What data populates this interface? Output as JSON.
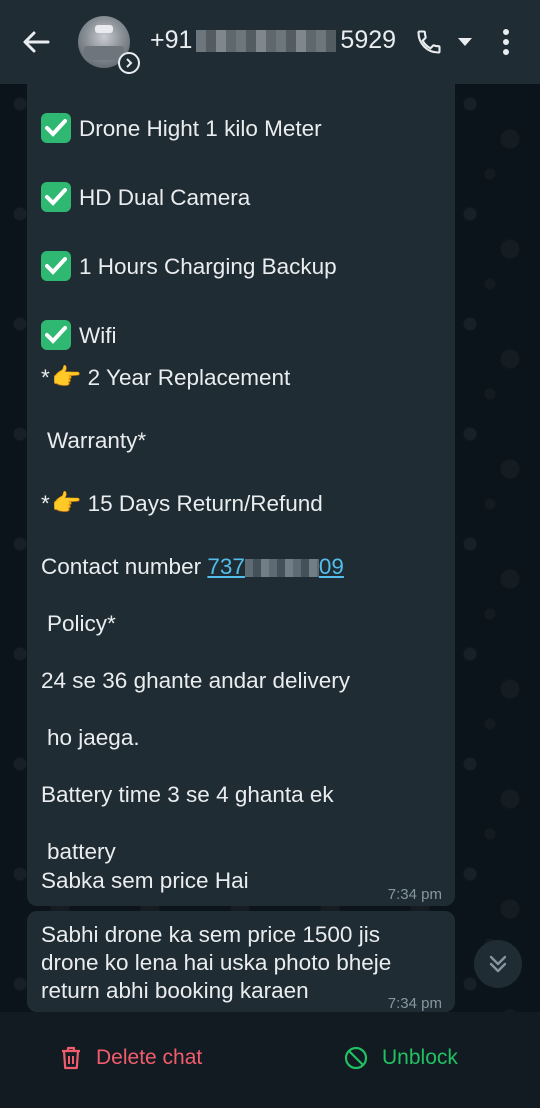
{
  "header": {
    "contact_prefix": "+91",
    "contact_suffix": "5929"
  },
  "messages": [
    {
      "lines": [
        "Drone Hight 1 kilo Meter",
        "HD Dual Camera",
        "1 Hours Charging Backup",
        "Wifi",
        "2 Year Replacement",
        "Warranty*",
        "15 Days Return/Refund",
        "Contact number",
        "Policy*",
        "24 se 36 ghante andar delivery",
        "ho jaega.",
        "Battery time 3 se 4 ghanta ek",
        "battery",
        "Sabka sem price Hai"
      ],
      "contact_link_prefix": "737",
      "contact_link_suffix": "09",
      "time": "7:34 pm"
    },
    {
      "lines": [
        "Sabhi drone ka sem price 1500 jis",
        "drone ko lena hai uska photo bheje",
        "return abhi booking karaen"
      ],
      "time": "7:34 pm"
    }
  ],
  "bottom": {
    "delete_label": "Delete chat",
    "unblock_label": "Unblock"
  },
  "colors": {
    "header_bg": "#1f2c34",
    "bubble_bg": "#202c33",
    "link": "#53bdeb",
    "delete": "#f15c6d",
    "unblock": "#21c063",
    "check": "#2eb872"
  },
  "icons": [
    "back-arrow-icon",
    "call-icon",
    "dropdown-icon",
    "more-vert-icon",
    "chevron-double-down-icon",
    "trash-icon",
    "unblock-icon",
    "checkmark-icon",
    "pointing-hand-icon",
    "info-chevron-icon"
  ]
}
